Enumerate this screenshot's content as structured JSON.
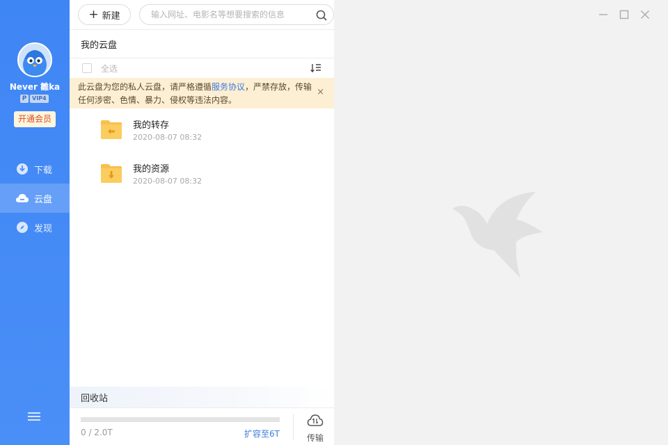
{
  "sidebar": {
    "username": "Never 雛ka",
    "vip_badge_p": "P",
    "vip_level": "VIP4",
    "member_button": "开通会员",
    "nav": [
      {
        "label": "下载",
        "icon": "download-icon"
      },
      {
        "label": "云盘",
        "icon": "cloud-icon",
        "active": true
      },
      {
        "label": "发现",
        "icon": "compass-icon"
      }
    ],
    "menu_icon": "hamburger-menu-icon"
  },
  "toolbar": {
    "new_label": "新建",
    "search_placeholder": "输入网址、电影名等想要搜索的信息",
    "search_icon": "search-icon"
  },
  "cloud": {
    "title": "我的云盘",
    "select_all": "全选",
    "sort_icon": "sort-icon"
  },
  "notice": {
    "text_before": "此云盘为您的私人云盘，请严格遵循",
    "link": "服务协议",
    "text_after": "，严禁存放，传输任何涉密、色情、暴力、侵权等违法内容。",
    "close": "×"
  },
  "files": [
    {
      "name": "我的转存",
      "date": "2020-08-07 08:32",
      "icon": "folder-transfer-icon"
    },
    {
      "name": "我的资源",
      "date": "2020-08-07 08:32",
      "icon": "folder-download-icon"
    }
  ],
  "recycle": {
    "label": "回收站"
  },
  "footer": {
    "storage": "0 / 2.0T",
    "usage_fraction": 0,
    "expand": "扩容至6T",
    "transfer": "传输",
    "transfer_icon": "cloud-transfer-icon"
  },
  "colors": {
    "accent": "#4a8ff7",
    "notice_bg": "#fdefd3",
    "folder": "#f8c04e",
    "link": "#3d7ae0"
  }
}
